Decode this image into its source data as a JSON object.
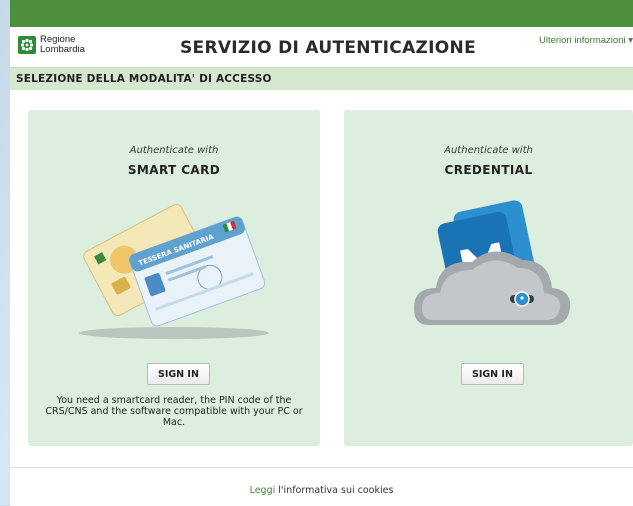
{
  "header": {
    "logo_line1": "Regione",
    "logo_line2": "Lombardia",
    "title": "SERVIZIO DI AUTENTICAZIONE",
    "more_info": "Ulteriori informazioni"
  },
  "section": {
    "title": "SELEZIONE DELLA MODALITA' DI ACCESSO"
  },
  "cards": [
    {
      "pre": "Authenticate with",
      "method": "SMART CARD",
      "button": "SIGN IN",
      "note": "You need a smartcard reader, the PIN code of the CRS/CNS and the software compatible with your PC or Mac.",
      "card_label": "TESSERA SANITARIA"
    },
    {
      "pre": "Authenticate with",
      "method": "CREDENTIAL",
      "button": "SIGN IN"
    }
  ],
  "footer": {
    "link": "Leggi",
    "text": "l'informativa sui cookies"
  },
  "colors": {
    "topbar": "#4e8f3e",
    "card_bg": "#dceedd",
    "section_bg": "#d7e8d0",
    "link": "#3d8a2c"
  }
}
